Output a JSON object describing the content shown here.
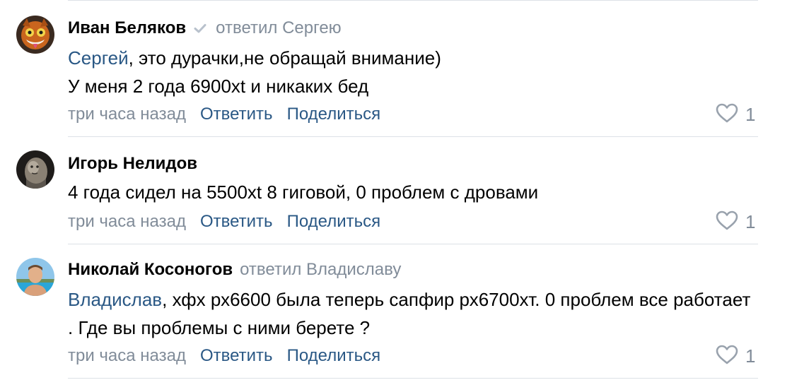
{
  "comments": [
    {
      "author": "Иван Беляков",
      "reply_to": "ответил Сергею",
      "mention": "Сергей",
      "text_after_mention": ", это дурачки,не обращай внимание)",
      "text_line2": "У меня 2 года 6900xt и никаких бед",
      "time": "три часа назад",
      "reply_label": "Ответить",
      "share_label": "Поделиться",
      "likes": "1",
      "avatar_icon": "cat-avatar"
    },
    {
      "author": "Игорь Нелидов",
      "text": "4 года сидел на 5500xt 8 гиговой, 0 проблем с дровами",
      "time": "три часа назад",
      "reply_label": "Ответить",
      "share_label": "Поделиться",
      "likes": "1",
      "avatar_icon": "sculpture-avatar"
    },
    {
      "author": "Николай Косоногов",
      "reply_to": "ответил Владиславу",
      "mention": "Владислав",
      "text_after_mention": ", хфх рх6600 была теперь сапфир рх6700хт. 0 проблем все работает . Где вы проблемы с ними берете ?",
      "time": "три часа назад",
      "reply_label": "Ответить",
      "share_label": "Поделиться",
      "likes": "1",
      "avatar_icon": "person-avatar"
    }
  ],
  "colors": {
    "link": "#2a5885",
    "secondary": "#818c99",
    "divider": "#dce1e6"
  }
}
